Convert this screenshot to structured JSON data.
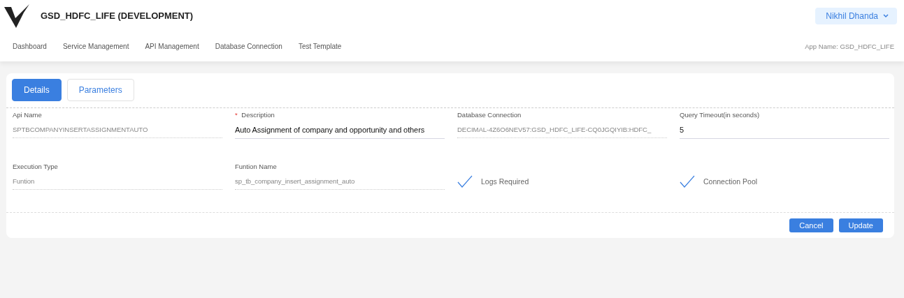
{
  "header": {
    "title": "GSD_HDFC_LIFE (DEVELOPMENT)",
    "user_menu": "Nikhil Dhanda"
  },
  "nav": {
    "items": [
      {
        "label": "Dashboard"
      },
      {
        "label": "Service Management"
      },
      {
        "label": "API Management"
      },
      {
        "label": "Database Connection"
      },
      {
        "label": "Test Template"
      }
    ],
    "app_name": "App Name: GSD_HDFC_LIFE"
  },
  "tabs": [
    {
      "label": "Details",
      "selected": true
    },
    {
      "label": "Parameters",
      "selected": false
    }
  ],
  "fields": [
    {
      "kind": "text",
      "label": "Api Name",
      "value": "SPTBCOMPANYINSERTASSIGNMENTAUTO",
      "disabled": true
    },
    {
      "kind": "text",
      "label": "Description",
      "value": "Auto Assignment of company and opportunity and others",
      "disabled": false,
      "required_mark": "*"
    },
    {
      "kind": "text",
      "label": "Database Connection",
      "value": "DECIMAL-4Z6O6NEV57:GSD_HDFC_LIFE-CQ0JGQIYIB:HDFC_",
      "disabled": true
    },
    {
      "kind": "text",
      "label": "Query Timeout(in seconds)",
      "value": "5",
      "disabled": false
    },
    {
      "kind": "text",
      "label": "Execution Type",
      "value": "Funtion",
      "disabled": true
    },
    {
      "kind": "text",
      "label": "Funtion Name",
      "value": "sp_tb_company_insert_assignment_auto",
      "disabled": true
    },
    {
      "kind": "checkbox",
      "label": "Logs Required",
      "checked": true
    },
    {
      "kind": "checkbox",
      "label": "Connection Pool",
      "checked": true
    }
  ],
  "buttons": [
    "Cancel",
    "Update"
  ]
}
